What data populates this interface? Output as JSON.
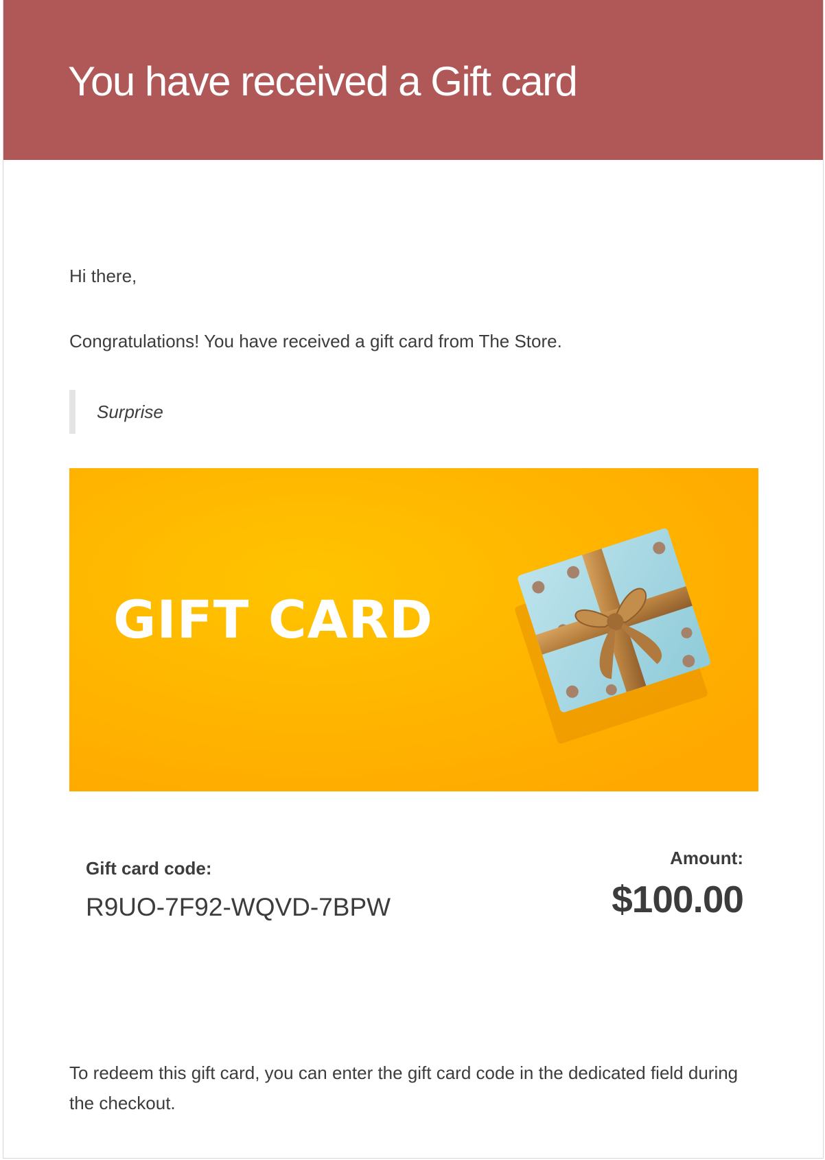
{
  "header": {
    "title": "You have received a Gift card",
    "background_color": "#b05857"
  },
  "body": {
    "greeting": "Hi there,",
    "intro": "Congratulations! You have received a gift card from The Store.",
    "message": "Surprise"
  },
  "gift_image": {
    "text": "GIFT CARD",
    "icon": "gift-box-icon",
    "background_color": "#ffb300"
  },
  "gift_card": {
    "code_label": "Gift card code:",
    "code": "R9UO-7F92-WQVD-7BPW",
    "amount_label": "Amount:",
    "amount": "$100.00"
  },
  "footer": {
    "redeem_text": "To redeem this gift card, you can enter the gift card code in the dedicated field during the checkout."
  }
}
